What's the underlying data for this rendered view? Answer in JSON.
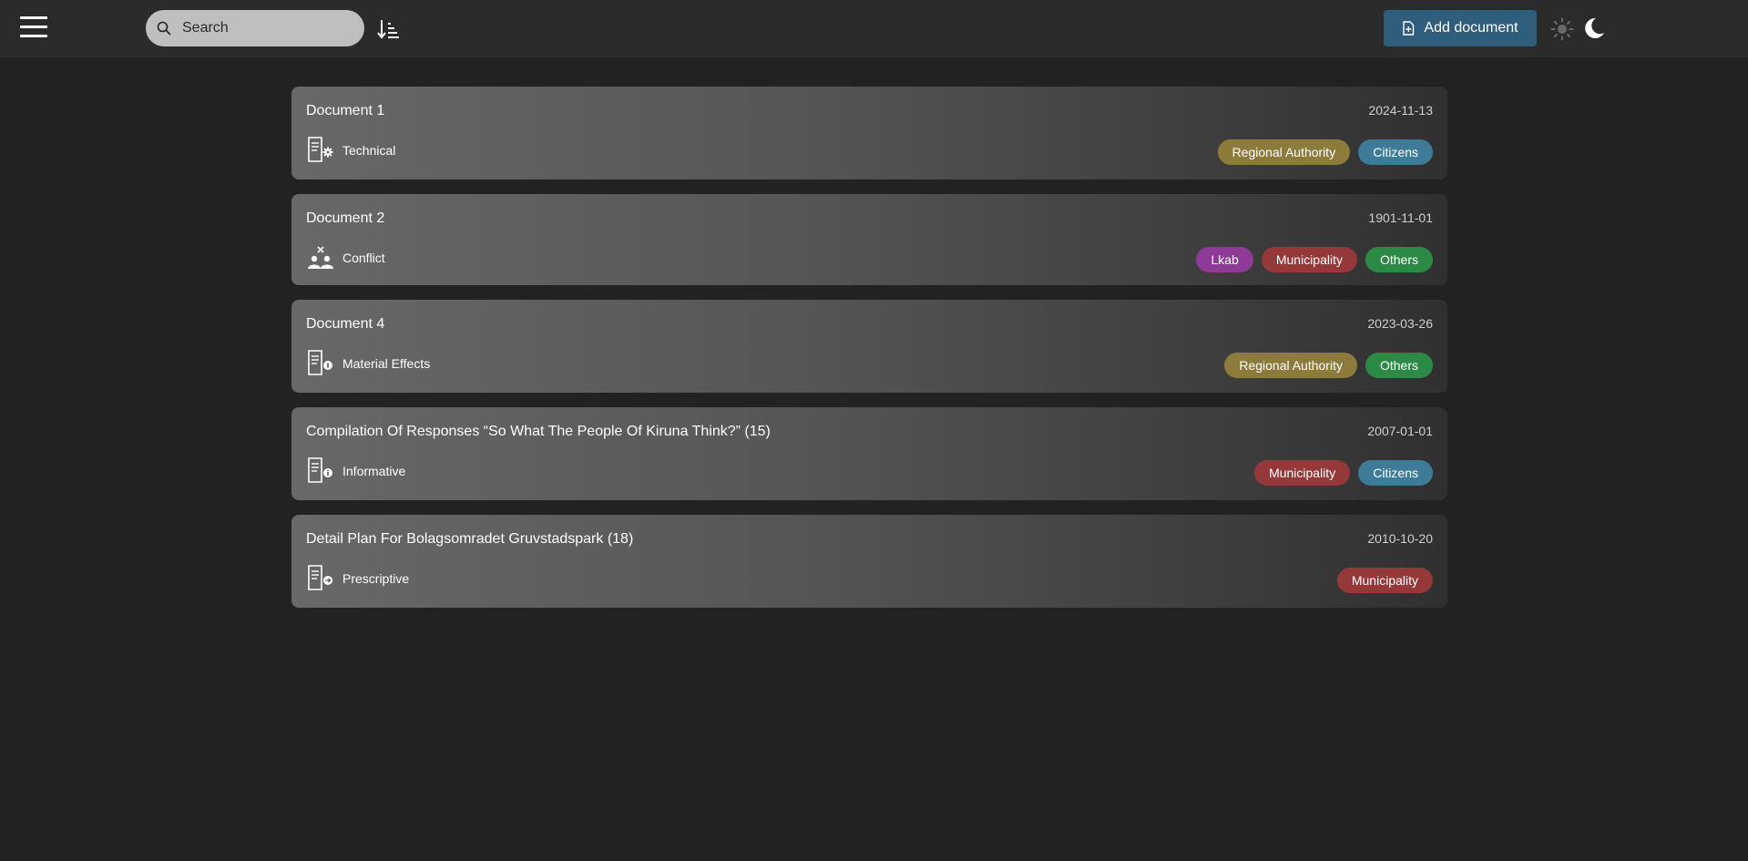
{
  "header": {
    "search_placeholder": "Search",
    "add_document_label": "Add document"
  },
  "stakeholder_colors": {
    "Regional Authority": "#8d7b3c",
    "Citizens": "#3d7b97",
    "Lkab": "#8d3b96",
    "Municipality": "#953839",
    "Others": "#2d8a46"
  },
  "documents": [
    {
      "title": "Document 1",
      "date": "2024-11-13",
      "type": "Technical",
      "type_icon": "technical-document-icon",
      "stakeholders": [
        "Regional Authority",
        "Citizens"
      ]
    },
    {
      "title": "Document 2",
      "date": "1901-11-01",
      "type": "Conflict",
      "type_icon": "conflict-icon",
      "stakeholders": [
        "Lkab",
        "Municipality",
        "Others"
      ]
    },
    {
      "title": "Document 4",
      "date": "2023-03-26",
      "type": "Material Effects",
      "type_icon": "material-effects-document-icon",
      "stakeholders": [
        "Regional Authority",
        "Others"
      ]
    },
    {
      "title": "Compilation Of Responses “So What The People Of Kiruna Think?” (15)",
      "date": "2007-01-01",
      "type": "Informative",
      "type_icon": "informative-document-icon",
      "stakeholders": [
        "Municipality",
        "Citizens"
      ]
    },
    {
      "title": "Detail Plan For Bolagsomradet Gruvstadspark (18)",
      "date": "2010-10-20",
      "type": "Prescriptive",
      "type_icon": "prescriptive-document-icon",
      "stakeholders": [
        "Municipality"
      ]
    }
  ]
}
